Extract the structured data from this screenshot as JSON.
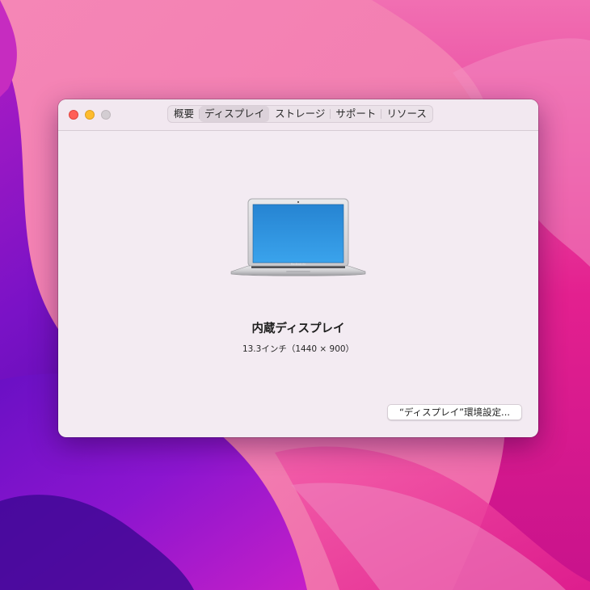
{
  "window": {
    "tabs": [
      {
        "label": "概要",
        "active": false
      },
      {
        "label": "ディスプレイ",
        "active": true
      },
      {
        "label": "ストレージ",
        "active": false
      },
      {
        "label": "サポート",
        "active": false
      },
      {
        "label": "リソース",
        "active": false
      }
    ]
  },
  "display": {
    "name": "内蔵ディスプレイ",
    "spec": "13.3インチ（1440 × 900）",
    "icon": "laptop-icon"
  },
  "actions": {
    "prefs_button": "“ディスプレイ”環境設定..."
  },
  "colors": {
    "close": "#ff5f57",
    "minimize": "#febc2e",
    "zoom_disabled": "#d3cdd2",
    "window_bg": "#f3ebf2",
    "screen_blue": "#2d8fdc"
  }
}
